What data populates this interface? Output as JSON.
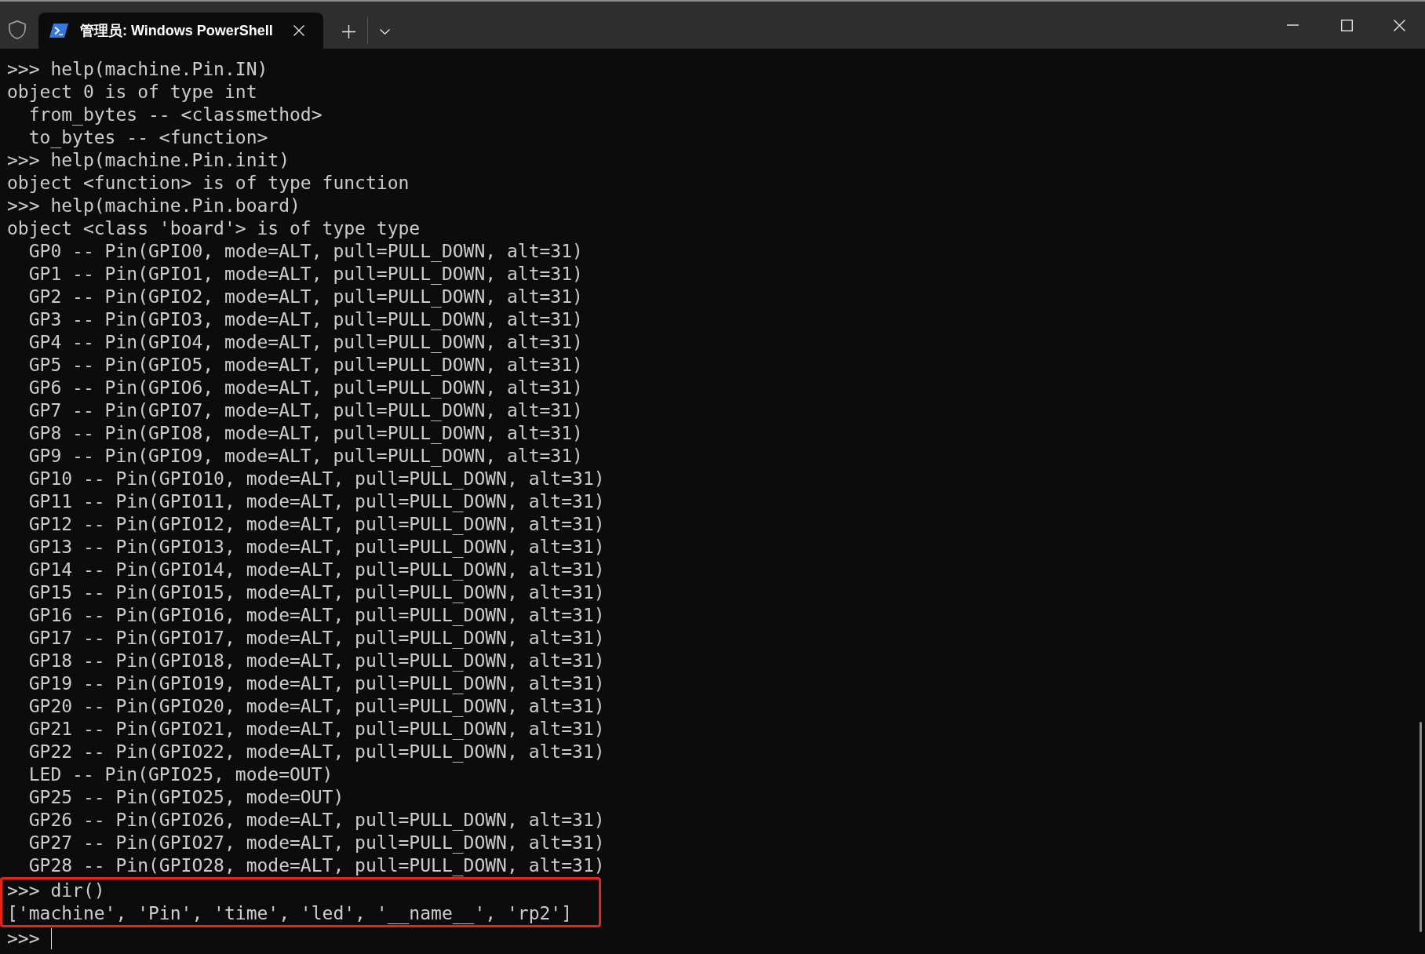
{
  "window": {
    "tabs": [
      {
        "title": "管理员: Windows PowerShell",
        "selected": true
      }
    ]
  },
  "terminal": {
    "lines": [
      {
        "text": ">>> help(machine.Pin.IN)",
        "highlighted": false
      },
      {
        "text": "object 0 is of type int",
        "highlighted": false
      },
      {
        "text": "  from_bytes -- <classmethod>",
        "highlighted": false
      },
      {
        "text": "  to_bytes -- <function>",
        "highlighted": false
      },
      {
        "text": ">>> help(machine.Pin.init)",
        "highlighted": false
      },
      {
        "text": "object <function> is of type function",
        "highlighted": false
      },
      {
        "text": ">>> help(machine.Pin.board)",
        "highlighted": false
      },
      {
        "text": "object <class 'board'> is of type type",
        "highlighted": false
      },
      {
        "text": "  GP0 -- Pin(GPIO0, mode=ALT, pull=PULL_DOWN, alt=31)",
        "highlighted": false
      },
      {
        "text": "  GP1 -- Pin(GPIO1, mode=ALT, pull=PULL_DOWN, alt=31)",
        "highlighted": false
      },
      {
        "text": "  GP2 -- Pin(GPIO2, mode=ALT, pull=PULL_DOWN, alt=31)",
        "highlighted": false
      },
      {
        "text": "  GP3 -- Pin(GPIO3, mode=ALT, pull=PULL_DOWN, alt=31)",
        "highlighted": false
      },
      {
        "text": "  GP4 -- Pin(GPIO4, mode=ALT, pull=PULL_DOWN, alt=31)",
        "highlighted": false
      },
      {
        "text": "  GP5 -- Pin(GPIO5, mode=ALT, pull=PULL_DOWN, alt=31)",
        "highlighted": false
      },
      {
        "text": "  GP6 -- Pin(GPIO6, mode=ALT, pull=PULL_DOWN, alt=31)",
        "highlighted": false
      },
      {
        "text": "  GP7 -- Pin(GPIO7, mode=ALT, pull=PULL_DOWN, alt=31)",
        "highlighted": false
      },
      {
        "text": "  GP8 -- Pin(GPIO8, mode=ALT, pull=PULL_DOWN, alt=31)",
        "highlighted": false
      },
      {
        "text": "  GP9 -- Pin(GPIO9, mode=ALT, pull=PULL_DOWN, alt=31)",
        "highlighted": false
      },
      {
        "text": "  GP10 -- Pin(GPIO10, mode=ALT, pull=PULL_DOWN, alt=31)",
        "highlighted": false
      },
      {
        "text": "  GP11 -- Pin(GPIO11, mode=ALT, pull=PULL_DOWN, alt=31)",
        "highlighted": false
      },
      {
        "text": "  GP12 -- Pin(GPIO12, mode=ALT, pull=PULL_DOWN, alt=31)",
        "highlighted": false
      },
      {
        "text": "  GP13 -- Pin(GPIO13, mode=ALT, pull=PULL_DOWN, alt=31)",
        "highlighted": false
      },
      {
        "text": "  GP14 -- Pin(GPIO14, mode=ALT, pull=PULL_DOWN, alt=31)",
        "highlighted": false
      },
      {
        "text": "  GP15 -- Pin(GPIO15, mode=ALT, pull=PULL_DOWN, alt=31)",
        "highlighted": false
      },
      {
        "text": "  GP16 -- Pin(GPIO16, mode=ALT, pull=PULL_DOWN, alt=31)",
        "highlighted": false
      },
      {
        "text": "  GP17 -- Pin(GPIO17, mode=ALT, pull=PULL_DOWN, alt=31)",
        "highlighted": false
      },
      {
        "text": "  GP18 -- Pin(GPIO18, mode=ALT, pull=PULL_DOWN, alt=31)",
        "highlighted": false
      },
      {
        "text": "  GP19 -- Pin(GPIO19, mode=ALT, pull=PULL_DOWN, alt=31)",
        "highlighted": false
      },
      {
        "text": "  GP20 -- Pin(GPIO20, mode=ALT, pull=PULL_DOWN, alt=31)",
        "highlighted": false
      },
      {
        "text": "  GP21 -- Pin(GPIO21, mode=ALT, pull=PULL_DOWN, alt=31)",
        "highlighted": false
      },
      {
        "text": "  GP22 -- Pin(GPIO22, mode=ALT, pull=PULL_DOWN, alt=31)",
        "highlighted": false
      },
      {
        "text": "  LED -- Pin(GPIO25, mode=OUT)",
        "highlighted": false
      },
      {
        "text": "  GP25 -- Pin(GPIO25, mode=OUT)",
        "highlighted": false
      },
      {
        "text": "  GP26 -- Pin(GPIO26, mode=ALT, pull=PULL_DOWN, alt=31)",
        "highlighted": false
      },
      {
        "text": "  GP27 -- Pin(GPIO27, mode=ALT, pull=PULL_DOWN, alt=31)",
        "highlighted": false
      },
      {
        "text": "  GP28 -- Pin(GPIO28, mode=ALT, pull=PULL_DOWN, alt=31)",
        "highlighted": false
      },
      {
        "text": ">>> dir()",
        "highlighted": true
      },
      {
        "text": "['machine', 'Pin', 'time', 'led', '__name__', 'rp2']",
        "highlighted": true
      }
    ],
    "input_line": {
      "text": ">>>",
      "cursor": true
    }
  }
}
